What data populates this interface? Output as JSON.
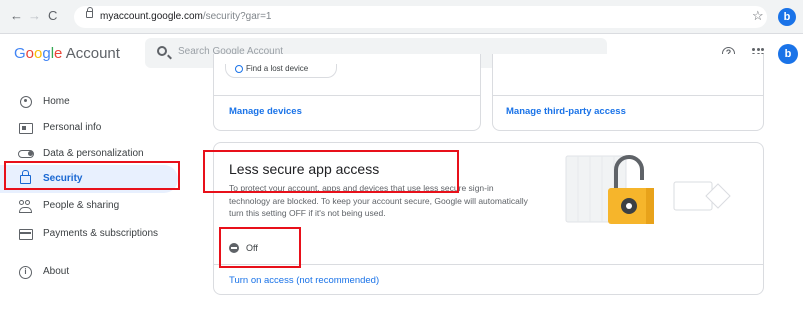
{
  "browser": {
    "back_glyph": "←",
    "forward_glyph": "→",
    "reload_glyph": "C",
    "url_host": "myaccount.google.com",
    "url_path": "/security?gar=1",
    "star_glyph": "☆",
    "profile_initial": "b"
  },
  "header": {
    "logo_letters": [
      "G",
      "o",
      "o",
      "g",
      "l",
      "e"
    ],
    "logo_suffix": " Account",
    "search_placeholder": "Search Google Account",
    "help_glyph": "?",
    "avatar_initial": "b"
  },
  "sidebar": {
    "items": [
      {
        "label": "Home",
        "icon": "home-icon"
      },
      {
        "label": "Personal info",
        "icon": "id-card-icon"
      },
      {
        "label": "Data & personalization",
        "icon": "toggle-icon"
      },
      {
        "label": "Security",
        "icon": "lock-icon",
        "active": true
      },
      {
        "label": "People & sharing",
        "icon": "people-icon"
      },
      {
        "label": "Payments & subscriptions",
        "icon": "credit-card-icon"
      },
      {
        "label": "About",
        "icon": "info-icon"
      }
    ]
  },
  "top_cards": {
    "find_device_label": "Find a lost device",
    "manage_devices_link": "Manage devices",
    "manage_third_party_link": "Manage third-party access"
  },
  "less_secure": {
    "title": "Less secure app access",
    "description": "To protect your account, apps and devices that use less secure sign-in technology are blocked. To keep your account secure, Google will automatically turn this setting OFF if it's not being used.",
    "status": "Off",
    "turn_on_link": "Turn on access (not recommended)"
  },
  "colors": {
    "accent": "#1a73e8",
    "highlight": "#e8101a",
    "padlock": "#f6b52b"
  }
}
